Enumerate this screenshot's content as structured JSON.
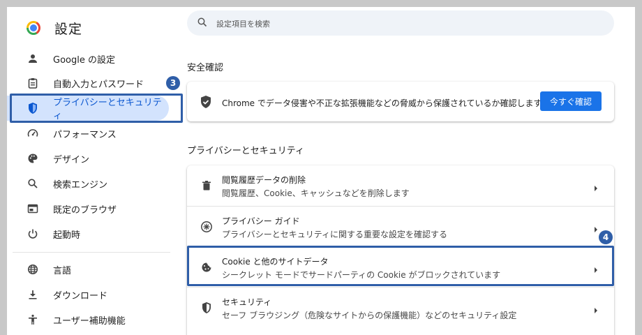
{
  "header": {
    "title": "設定"
  },
  "search": {
    "placeholder": "設定項目を検索"
  },
  "sidebar": {
    "items": [
      {
        "label": "Google の設定",
        "icon": "person-icon"
      },
      {
        "label": "自動入力とパスワード",
        "icon": "clipboard-icon"
      },
      {
        "label": "プライバシーとセキュリティ",
        "icon": "shield-icon",
        "active": true
      },
      {
        "label": "パフォーマンス",
        "icon": "speedometer-icon"
      },
      {
        "label": "デザイン",
        "icon": "palette-icon"
      },
      {
        "label": "検索エンジン",
        "icon": "search-icon"
      },
      {
        "label": "既定のブラウザ",
        "icon": "browser-window-icon"
      },
      {
        "label": "起動時",
        "icon": "power-icon"
      },
      {
        "label": "言語",
        "icon": "globe-icon"
      },
      {
        "label": "ダウンロード",
        "icon": "download-icon"
      },
      {
        "label": "ユーザー補助機能",
        "icon": "accessibility-icon"
      }
    ]
  },
  "annotations": {
    "badge_sidebar": "3",
    "badge_cookie": "4",
    "highlight_color": "#2f5ea8"
  },
  "safety": {
    "title": "安全確認",
    "text": "Chrome でデータ侵害や不正な拡張機能などの脅威から保護されているか確認します",
    "button": "今すぐ確認"
  },
  "privacy": {
    "title": "プライバシーとセキュリティ",
    "rows": [
      {
        "title": "閲覧履歴データの削除",
        "desc": "閲覧履歴、Cookie、キャッシュなどを削除します",
        "icon": "trash-icon"
      },
      {
        "title": "プライバシー ガイド",
        "desc": "プライバシーとセキュリティに関する重要な設定を確認する",
        "icon": "privacy-guide-icon"
      },
      {
        "title": "Cookie と他のサイトデータ",
        "desc": "シークレット モードでサードパーティの Cookie がブロックされています",
        "icon": "cookie-icon"
      },
      {
        "title": "セキュリティ",
        "desc": "セーフ ブラウジング（危険なサイトからの保護機能）などのセキュリティ設定",
        "icon": "shield-icon"
      }
    ]
  },
  "colors": {
    "accent": "#1a73e8",
    "active_bg": "#d3e3fd",
    "active_text": "#0b57d0"
  }
}
